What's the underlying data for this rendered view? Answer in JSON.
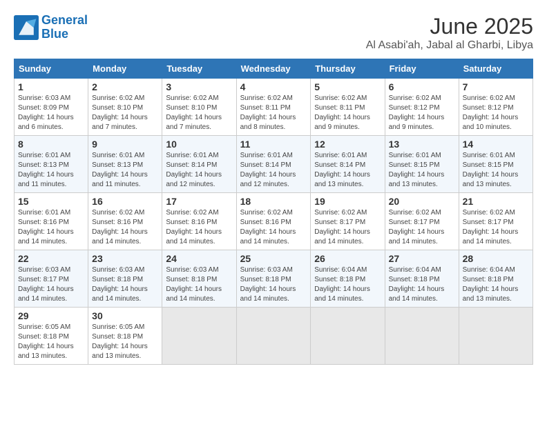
{
  "header": {
    "logo_line1": "General",
    "logo_line2": "Blue",
    "title": "June 2025",
    "subtitle": "Al Asabi'ah, Jabal al Gharbi, Libya"
  },
  "weekdays": [
    "Sunday",
    "Monday",
    "Tuesday",
    "Wednesday",
    "Thursday",
    "Friday",
    "Saturday"
  ],
  "weeks": [
    [
      {
        "day": 1,
        "sunrise": "6:03 AM",
        "sunset": "8:09 PM",
        "daylight": "14 hours and 6 minutes."
      },
      {
        "day": 2,
        "sunrise": "6:02 AM",
        "sunset": "8:10 PM",
        "daylight": "14 hours and 7 minutes."
      },
      {
        "day": 3,
        "sunrise": "6:02 AM",
        "sunset": "8:10 PM",
        "daylight": "14 hours and 7 minutes."
      },
      {
        "day": 4,
        "sunrise": "6:02 AM",
        "sunset": "8:11 PM",
        "daylight": "14 hours and 8 minutes."
      },
      {
        "day": 5,
        "sunrise": "6:02 AM",
        "sunset": "8:11 PM",
        "daylight": "14 hours and 9 minutes."
      },
      {
        "day": 6,
        "sunrise": "6:02 AM",
        "sunset": "8:12 PM",
        "daylight": "14 hours and 9 minutes."
      },
      {
        "day": 7,
        "sunrise": "6:02 AM",
        "sunset": "8:12 PM",
        "daylight": "14 hours and 10 minutes."
      }
    ],
    [
      {
        "day": 8,
        "sunrise": "6:01 AM",
        "sunset": "8:13 PM",
        "daylight": "14 hours and 11 minutes."
      },
      {
        "day": 9,
        "sunrise": "6:01 AM",
        "sunset": "8:13 PM",
        "daylight": "14 hours and 11 minutes."
      },
      {
        "day": 10,
        "sunrise": "6:01 AM",
        "sunset": "8:14 PM",
        "daylight": "14 hours and 12 minutes."
      },
      {
        "day": 11,
        "sunrise": "6:01 AM",
        "sunset": "8:14 PM",
        "daylight": "14 hours and 12 minutes."
      },
      {
        "day": 12,
        "sunrise": "6:01 AM",
        "sunset": "8:14 PM",
        "daylight": "14 hours and 13 minutes."
      },
      {
        "day": 13,
        "sunrise": "6:01 AM",
        "sunset": "8:15 PM",
        "daylight": "14 hours and 13 minutes."
      },
      {
        "day": 14,
        "sunrise": "6:01 AM",
        "sunset": "8:15 PM",
        "daylight": "14 hours and 13 minutes."
      }
    ],
    [
      {
        "day": 15,
        "sunrise": "6:01 AM",
        "sunset": "8:16 PM",
        "daylight": "14 hours and 14 minutes."
      },
      {
        "day": 16,
        "sunrise": "6:02 AM",
        "sunset": "8:16 PM",
        "daylight": "14 hours and 14 minutes."
      },
      {
        "day": 17,
        "sunrise": "6:02 AM",
        "sunset": "8:16 PM",
        "daylight": "14 hours and 14 minutes."
      },
      {
        "day": 18,
        "sunrise": "6:02 AM",
        "sunset": "8:16 PM",
        "daylight": "14 hours and 14 minutes."
      },
      {
        "day": 19,
        "sunrise": "6:02 AM",
        "sunset": "8:17 PM",
        "daylight": "14 hours and 14 minutes."
      },
      {
        "day": 20,
        "sunrise": "6:02 AM",
        "sunset": "8:17 PM",
        "daylight": "14 hours and 14 minutes."
      },
      {
        "day": 21,
        "sunrise": "6:02 AM",
        "sunset": "8:17 PM",
        "daylight": "14 hours and 14 minutes."
      }
    ],
    [
      {
        "day": 22,
        "sunrise": "6:03 AM",
        "sunset": "8:17 PM",
        "daylight": "14 hours and 14 minutes."
      },
      {
        "day": 23,
        "sunrise": "6:03 AM",
        "sunset": "8:18 PM",
        "daylight": "14 hours and 14 minutes."
      },
      {
        "day": 24,
        "sunrise": "6:03 AM",
        "sunset": "8:18 PM",
        "daylight": "14 hours and 14 minutes."
      },
      {
        "day": 25,
        "sunrise": "6:03 AM",
        "sunset": "8:18 PM",
        "daylight": "14 hours and 14 minutes."
      },
      {
        "day": 26,
        "sunrise": "6:04 AM",
        "sunset": "8:18 PM",
        "daylight": "14 hours and 14 minutes."
      },
      {
        "day": 27,
        "sunrise": "6:04 AM",
        "sunset": "8:18 PM",
        "daylight": "14 hours and 14 minutes."
      },
      {
        "day": 28,
        "sunrise": "6:04 AM",
        "sunset": "8:18 PM",
        "daylight": "14 hours and 13 minutes."
      }
    ],
    [
      {
        "day": 29,
        "sunrise": "6:05 AM",
        "sunset": "8:18 PM",
        "daylight": "14 hours and 13 minutes."
      },
      {
        "day": 30,
        "sunrise": "6:05 AM",
        "sunset": "8:18 PM",
        "daylight": "14 hours and 13 minutes."
      },
      null,
      null,
      null,
      null,
      null
    ]
  ]
}
